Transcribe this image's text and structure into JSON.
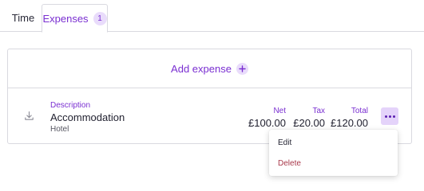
{
  "tabs": [
    {
      "label": "Time"
    },
    {
      "label": "Expenses",
      "badge": "1"
    }
  ],
  "add_expense": {
    "label": "Add expense"
  },
  "expense": {
    "description_label": "Description",
    "title": "Accommodation",
    "category": "Hotel",
    "net_label": "Net",
    "net_value": "£100.00",
    "tax_label": "Tax",
    "tax_value": "£20.00",
    "total_label": "Total",
    "total_value": "£120.00"
  },
  "menu": {
    "edit_label": "Edit",
    "delete_label": "Delete"
  },
  "icons": {
    "download": "download-icon",
    "add": "plus-icon",
    "more": "more-horizontal-icon"
  },
  "colors": {
    "accent": "#7a2fd1",
    "accent_light": "#e9dcfb",
    "danger": "#a8384a"
  }
}
